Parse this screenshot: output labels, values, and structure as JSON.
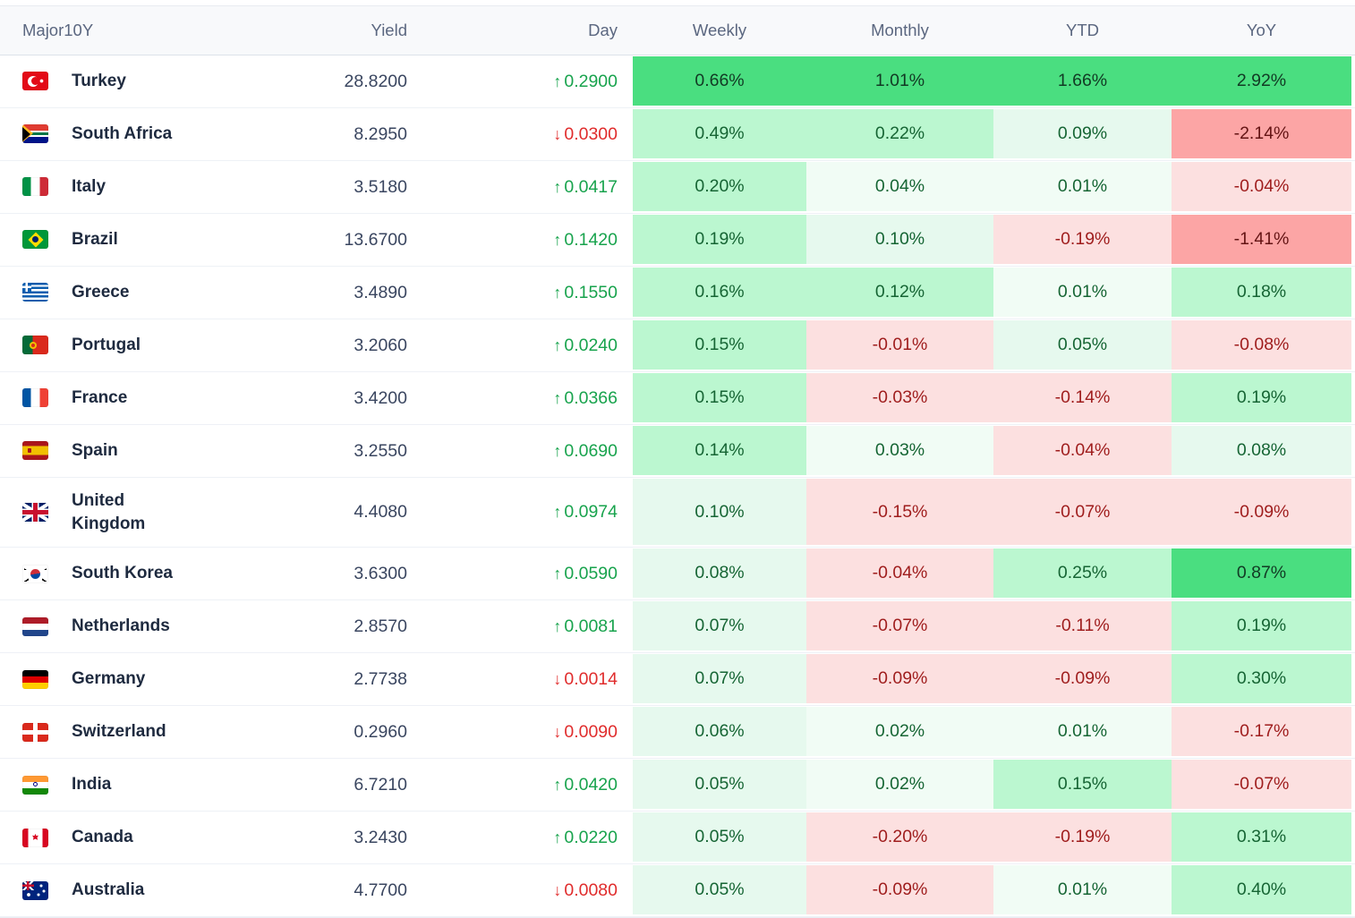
{
  "table": {
    "columns": [
      "Major10Y",
      "Yield",
      "Day",
      "Weekly",
      "Monthly",
      "YTD",
      "YoY"
    ],
    "icons": {
      "up_arrow": "↑",
      "down_arrow": "↓"
    },
    "palette": {
      "day_up": "#18a34d",
      "day_down": "#e02c2c",
      "country_text": "#1e2a3f",
      "yield_text": "#3a4660",
      "header_text": "#5b6780",
      "header_bg": "#f8f9fb",
      "tiers": {
        "g3": {
          "bg": "#4ade80",
          "fg": "#123a24"
        },
        "g2": {
          "bg": "#bbf7d0",
          "fg": "#166534"
        },
        "g1": {
          "bg": "#e6f9ee",
          "fg": "#166534"
        },
        "g0": {
          "bg": "#f1fcf5",
          "fg": "#166534"
        },
        "r3": {
          "bg": "#fca5a5",
          "fg": "#641414"
        },
        "r1": {
          "bg": "#fce0e0",
          "fg": "#9f1d1d"
        }
      }
    },
    "rows": [
      {
        "country": "Turkey",
        "flag": "turkey",
        "yield": "28.8200",
        "day": {
          "dir": "up",
          "value": "0.2900"
        },
        "cells": [
          {
            "value": "0.66%",
            "tier": "g3"
          },
          {
            "value": "1.01%",
            "tier": "g3"
          },
          {
            "value": "1.66%",
            "tier": "g3"
          },
          {
            "value": "2.92%",
            "tier": "g3"
          }
        ]
      },
      {
        "country": "South Africa",
        "flag": "southafrica",
        "yield": "8.2950",
        "day": {
          "dir": "down",
          "value": "0.0300"
        },
        "cells": [
          {
            "value": "0.49%",
            "tier": "g2"
          },
          {
            "value": "0.22%",
            "tier": "g2"
          },
          {
            "value": "0.09%",
            "tier": "g1"
          },
          {
            "value": "-2.14%",
            "tier": "r3"
          }
        ]
      },
      {
        "country": "Italy",
        "flag": "italy",
        "yield": "3.5180",
        "day": {
          "dir": "up",
          "value": "0.0417"
        },
        "cells": [
          {
            "value": "0.20%",
            "tier": "g2"
          },
          {
            "value": "0.04%",
            "tier": "g0"
          },
          {
            "value": "0.01%",
            "tier": "g0"
          },
          {
            "value": "-0.04%",
            "tier": "r1"
          }
        ]
      },
      {
        "country": "Brazil",
        "flag": "brazil",
        "yield": "13.6700",
        "day": {
          "dir": "up",
          "value": "0.1420"
        },
        "cells": [
          {
            "value": "0.19%",
            "tier": "g2"
          },
          {
            "value": "0.10%",
            "tier": "g1"
          },
          {
            "value": "-0.19%",
            "tier": "r1"
          },
          {
            "value": "-1.41%",
            "tier": "r3"
          }
        ]
      },
      {
        "country": "Greece",
        "flag": "greece",
        "yield": "3.4890",
        "day": {
          "dir": "up",
          "value": "0.1550"
        },
        "cells": [
          {
            "value": "0.16%",
            "tier": "g2"
          },
          {
            "value": "0.12%",
            "tier": "g2"
          },
          {
            "value": "0.01%",
            "tier": "g0"
          },
          {
            "value": "0.18%",
            "tier": "g2"
          }
        ]
      },
      {
        "country": "Portugal",
        "flag": "portugal",
        "yield": "3.2060",
        "day": {
          "dir": "up",
          "value": "0.0240"
        },
        "cells": [
          {
            "value": "0.15%",
            "tier": "g2"
          },
          {
            "value": "-0.01%",
            "tier": "r1"
          },
          {
            "value": "0.05%",
            "tier": "g1"
          },
          {
            "value": "-0.08%",
            "tier": "r1"
          }
        ]
      },
      {
        "country": "France",
        "flag": "france",
        "yield": "3.4200",
        "day": {
          "dir": "up",
          "value": "0.0366"
        },
        "cells": [
          {
            "value": "0.15%",
            "tier": "g2"
          },
          {
            "value": "-0.03%",
            "tier": "r1"
          },
          {
            "value": "-0.14%",
            "tier": "r1"
          },
          {
            "value": "0.19%",
            "tier": "g2"
          }
        ]
      },
      {
        "country": "Spain",
        "flag": "spain",
        "yield": "3.2550",
        "day": {
          "dir": "up",
          "value": "0.0690"
        },
        "cells": [
          {
            "value": "0.14%",
            "tier": "g2"
          },
          {
            "value": "0.03%",
            "tier": "g0"
          },
          {
            "value": "-0.04%",
            "tier": "r1"
          },
          {
            "value": "0.08%",
            "tier": "g1"
          }
        ]
      },
      {
        "country": "United Kingdom",
        "flag": "uk",
        "yield": "4.4080",
        "day": {
          "dir": "up",
          "value": "0.0974"
        },
        "cells": [
          {
            "value": "0.10%",
            "tier": "g1"
          },
          {
            "value": "-0.15%",
            "tier": "r1"
          },
          {
            "value": "-0.07%",
            "tier": "r1"
          },
          {
            "value": "-0.09%",
            "tier": "r1"
          }
        ]
      },
      {
        "country": "South Korea",
        "flag": "southkorea",
        "yield": "3.6300",
        "day": {
          "dir": "up",
          "value": "0.0590"
        },
        "cells": [
          {
            "value": "0.08%",
            "tier": "g1"
          },
          {
            "value": "-0.04%",
            "tier": "r1"
          },
          {
            "value": "0.25%",
            "tier": "g2"
          },
          {
            "value": "0.87%",
            "tier": "g3"
          }
        ]
      },
      {
        "country": "Netherlands",
        "flag": "netherlands",
        "yield": "2.8570",
        "day": {
          "dir": "up",
          "value": "0.0081"
        },
        "cells": [
          {
            "value": "0.07%",
            "tier": "g1"
          },
          {
            "value": "-0.07%",
            "tier": "r1"
          },
          {
            "value": "-0.11%",
            "tier": "r1"
          },
          {
            "value": "0.19%",
            "tier": "g2"
          }
        ]
      },
      {
        "country": "Germany",
        "flag": "germany",
        "yield": "2.7738",
        "day": {
          "dir": "down",
          "value": "0.0014"
        },
        "cells": [
          {
            "value": "0.07%",
            "tier": "g1"
          },
          {
            "value": "-0.09%",
            "tier": "r1"
          },
          {
            "value": "-0.09%",
            "tier": "r1"
          },
          {
            "value": "0.30%",
            "tier": "g2"
          }
        ]
      },
      {
        "country": "Switzerland",
        "flag": "switzerland",
        "yield": "0.2960",
        "day": {
          "dir": "down",
          "value": "0.0090"
        },
        "cells": [
          {
            "value": "0.06%",
            "tier": "g1"
          },
          {
            "value": "0.02%",
            "tier": "g0"
          },
          {
            "value": "0.01%",
            "tier": "g0"
          },
          {
            "value": "-0.17%",
            "tier": "r1"
          }
        ]
      },
      {
        "country": "India",
        "flag": "india",
        "yield": "6.7210",
        "day": {
          "dir": "up",
          "value": "0.0420"
        },
        "cells": [
          {
            "value": "0.05%",
            "tier": "g1"
          },
          {
            "value": "0.02%",
            "tier": "g0"
          },
          {
            "value": "0.15%",
            "tier": "g2"
          },
          {
            "value": "-0.07%",
            "tier": "r1"
          }
        ]
      },
      {
        "country": "Canada",
        "flag": "canada",
        "yield": "3.2430",
        "day": {
          "dir": "up",
          "value": "0.0220"
        },
        "cells": [
          {
            "value": "0.05%",
            "tier": "g1"
          },
          {
            "value": "-0.20%",
            "tier": "r1"
          },
          {
            "value": "-0.19%",
            "tier": "r1"
          },
          {
            "value": "0.31%",
            "tier": "g2"
          }
        ]
      },
      {
        "country": "Australia",
        "flag": "australia",
        "yield": "4.7700",
        "day": {
          "dir": "down",
          "value": "0.0080"
        },
        "cells": [
          {
            "value": "0.05%",
            "tier": "g1"
          },
          {
            "value": "-0.09%",
            "tier": "r1"
          },
          {
            "value": "0.01%",
            "tier": "g0"
          },
          {
            "value": "0.40%",
            "tier": "g2"
          }
        ]
      }
    ]
  }
}
